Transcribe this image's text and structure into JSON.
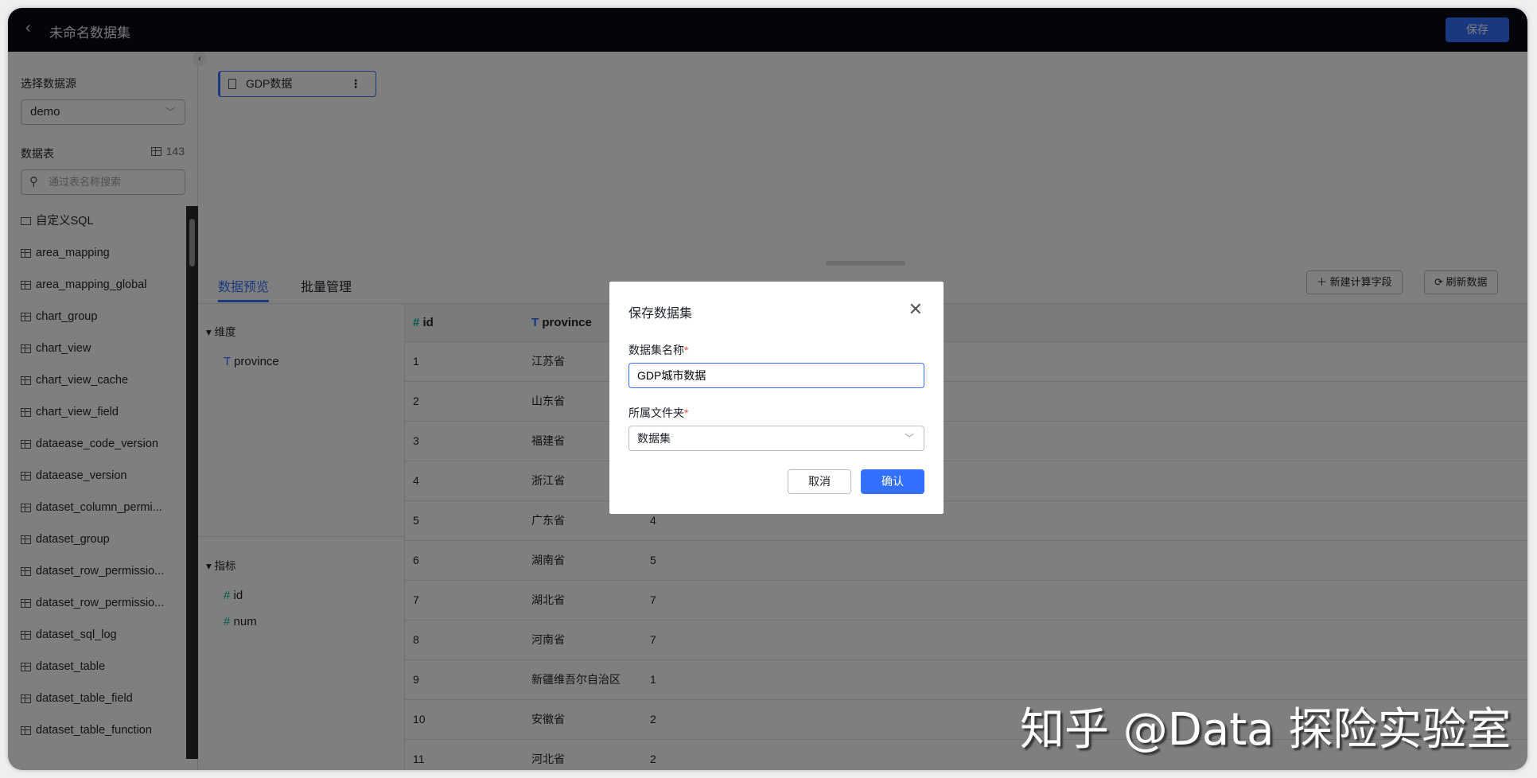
{
  "header": {
    "title": "未命名数据集",
    "save_label": "保存"
  },
  "sidebar": {
    "datasource_label": "选择数据源",
    "datasource_value": "demo",
    "tables_label": "数据表",
    "table_count": "143",
    "search_placeholder": "通过表名称搜索",
    "items": [
      {
        "label": "自定义SQL",
        "icon": "sql-icon"
      },
      {
        "label": "area_mapping"
      },
      {
        "label": "area_mapping_global"
      },
      {
        "label": "chart_group"
      },
      {
        "label": "chart_view"
      },
      {
        "label": "chart_view_cache"
      },
      {
        "label": "chart_view_field"
      },
      {
        "label": "dataease_code_version"
      },
      {
        "label": "dataease_version"
      },
      {
        "label": "dataset_column_permi..."
      },
      {
        "label": "dataset_group"
      },
      {
        "label": "dataset_row_permissio..."
      },
      {
        "label": "dataset_row_permissio..."
      },
      {
        "label": "dataset_sql_log"
      },
      {
        "label": "dataset_table"
      },
      {
        "label": "dataset_table_field"
      },
      {
        "label": "dataset_table_function"
      }
    ]
  },
  "canvas": {
    "node_label": "GDP数据"
  },
  "tabs": [
    {
      "label": "数据预览",
      "active": true
    },
    {
      "label": "批量管理",
      "active": false
    }
  ],
  "actions": {
    "new_field": "新建计算字段",
    "refresh": "刷新数据"
  },
  "fields": {
    "dimension_label": "维度",
    "dimensions": [
      "province"
    ],
    "measure_label": "指标",
    "measures": [
      "id",
      "num"
    ]
  },
  "table": {
    "columns": [
      "id",
      "province"
    ],
    "rows": [
      [
        "1",
        "江苏省",
        ""
      ],
      [
        "2",
        "山东省",
        ""
      ],
      [
        "3",
        "福建省",
        ""
      ],
      [
        "4",
        "浙江省",
        ""
      ],
      [
        "5",
        "广东省",
        "4"
      ],
      [
        "6",
        "湖南省",
        "5"
      ],
      [
        "7",
        "湖北省",
        "7"
      ],
      [
        "8",
        "河南省",
        "7"
      ],
      [
        "9",
        "新疆维吾尔自治区",
        "1"
      ],
      [
        "10",
        "安徽省",
        "2"
      ],
      [
        "11",
        "河北省",
        "2"
      ]
    ]
  },
  "dialog": {
    "title": "保存数据集",
    "name_label": "数据集名称",
    "name_value": "GDP城市数据",
    "folder_label": "所属文件夹",
    "folder_value": "数据集",
    "cancel": "取消",
    "confirm": "确认",
    "required_mark": "*"
  },
  "watermark": "知乎 @Data 探险实验室",
  "colors": {
    "accent": "#3370ff",
    "header_bg": "#060a14",
    "number_type": "#04b49c"
  }
}
